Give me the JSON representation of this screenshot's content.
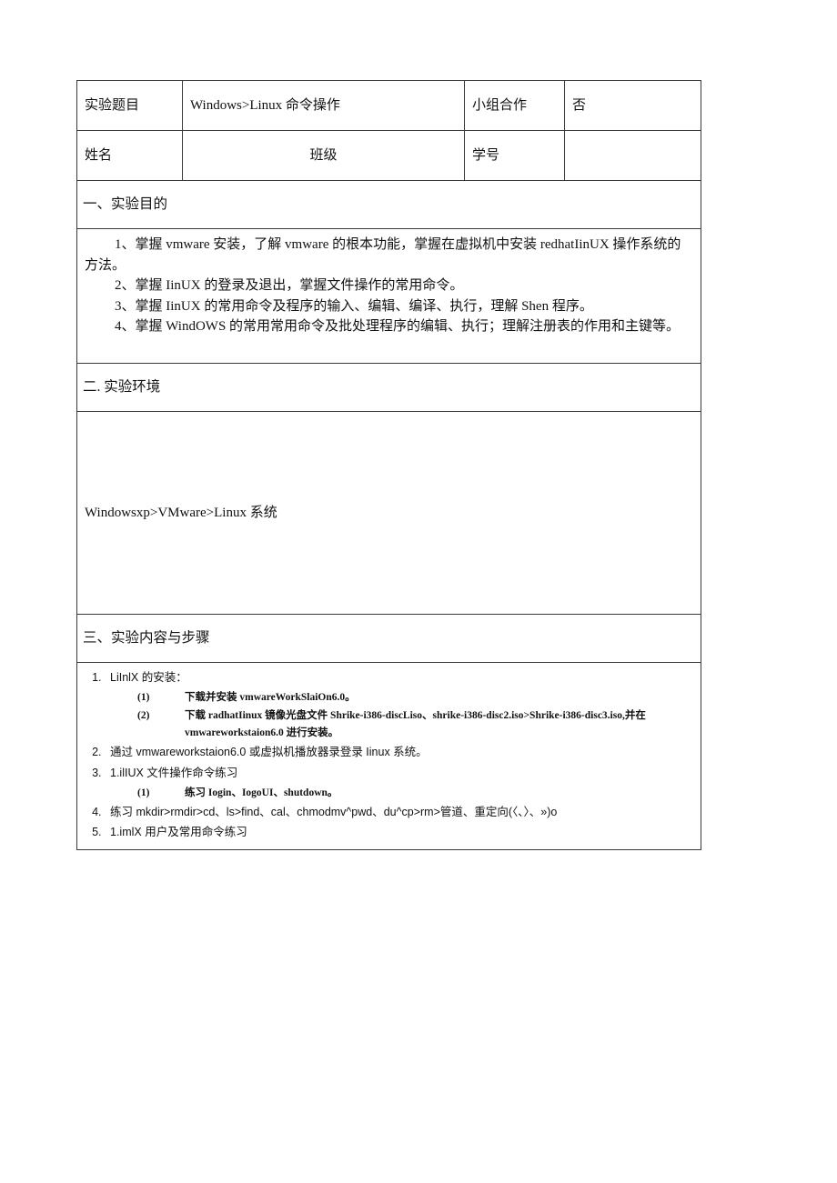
{
  "document": {
    "header_rows": [
      {
        "label": "实验题目",
        "title": "Windows>Linux 命令操作",
        "coop_label": "小组合作",
        "coop_value": "否"
      },
      {
        "label": "姓名",
        "class_label": "班级",
        "id_label": "学号",
        "id_value": ""
      }
    ],
    "sections": [
      {
        "heading": "一、实验目的",
        "paragraphs": [
          "1、掌握 vmware 安装，了解 vmware 的根本功能，掌握在虚拟机中安装 redhatIinUX 操作系统的方法。",
          "2、掌握 IinUX 的登录及退出，掌握文件操作的常用命令。",
          "3、掌握 IinUX 的常用命令及程序的输入、编辑、编译、执行，理解 Shen 程序。",
          "4、掌握 WindOWS 的常用常用命令及批处理程序的编辑、执行；理解注册表的作用和主键等。"
        ]
      },
      {
        "heading": "二. 实验环境",
        "body": "Windowsxp>VMware>Linux 系统"
      },
      {
        "heading": "三、实验内容与步骤"
      }
    ],
    "steps": [
      {
        "text": "LiInlX 的安装：",
        "substeps": [
          {
            "marker": "(1)",
            "text": "下载并安装 vmwareWorkSlaiOn6.0。"
          },
          {
            "marker": "(2)",
            "text": "下载 radhatIinux 镜像光盘文件 Shrike-i386-discLiso、shrike-i386-disc2.iso>Shrike-i386-disc3.iso,并在 vmwareworkstaion6.0 进行安装。"
          }
        ]
      },
      {
        "text": "通过 vmwareworkstaion6.0 或虚拟机播放器录登录 Iinux 系统。",
        "substeps": []
      },
      {
        "text": "1.ilIUX 文件操作命令练习",
        "substeps": [
          {
            "marker": "(1)",
            "text": "练习 Iogin、IogoUI、shutdown。"
          }
        ]
      },
      {
        "text": "练习 mkdir>rmdir>cd、ls>find、cal、chmodmv^pwd、du^cp>rm>管道、重定向(〈、〉、»)o",
        "substeps": []
      },
      {
        "text": "1.imlX 用户及常用命令练习",
        "substeps": []
      }
    ]
  }
}
